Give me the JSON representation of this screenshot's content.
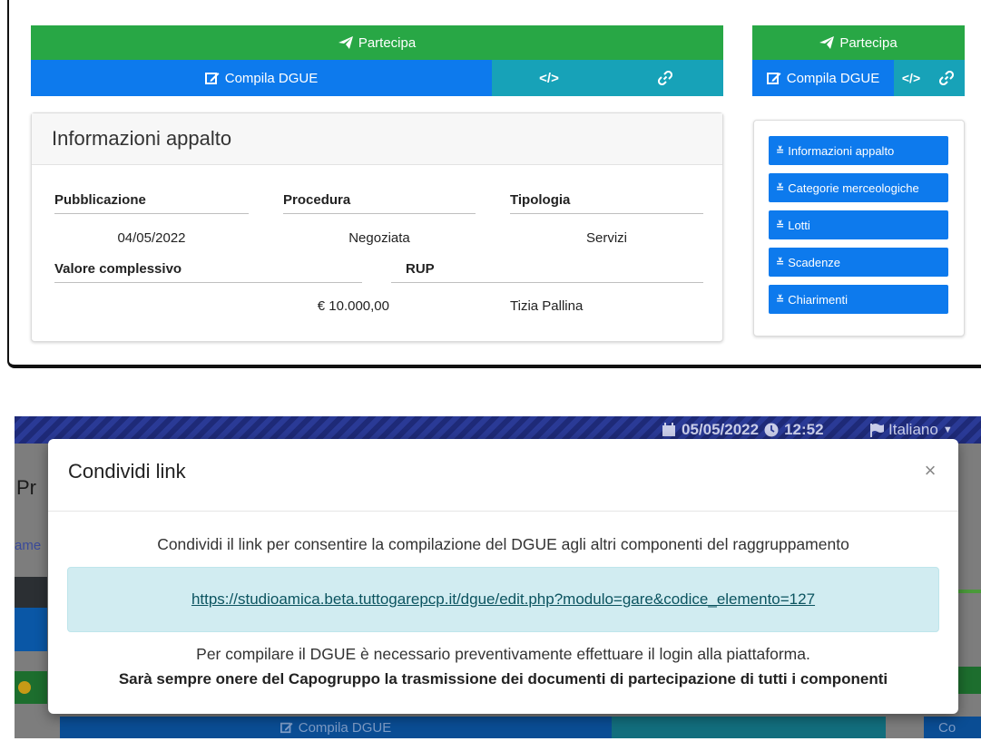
{
  "top": {
    "main_actions": {
      "participate_label": "Partecipa",
      "compile_label": "Compila DGUE",
      "embed_label": "</>"
    },
    "side_actions": {
      "participate_label": "Partecipa",
      "compile_label": "Compila DGUE",
      "embed_label": "</>"
    },
    "info_card": {
      "title": "Informazioni appalto",
      "headers_row1": [
        "Pubblicazione",
        "Procedura",
        "Tipologia"
      ],
      "values_row1": [
        "04/05/2022",
        "Negoziata",
        "Servizi"
      ],
      "headers_row2": [
        "Valore complessivo",
        "RUP"
      ],
      "values_row2": [
        "€ 10.000,00",
        "Tizia Pallina"
      ]
    },
    "side_menu": [
      {
        "label": "Informazioni appalto"
      },
      {
        "label": "Categorie merceologiche"
      },
      {
        "label": "Lotti"
      },
      {
        "label": "Scadenze"
      },
      {
        "label": "Chiarimenti"
      }
    ]
  },
  "bottom": {
    "header": {
      "date": "05/05/2022",
      "time": "12:52",
      "language": "Italiano"
    },
    "background_fragments": {
      "left_title": "Pr",
      "left_tab": "ame",
      "compile_label": "Compila DGUE",
      "right_fragment": "Co"
    },
    "modal": {
      "title": "Condividi link",
      "close_symbol": "×",
      "intro": "Condividi il link per consentire la compilazione del DGUE agli altri componenti del raggruppamento",
      "link": "https://studioamica.beta.tuttogarepcp.it/dgue/edit.php?modulo=gare&codice_elemento=127",
      "note": "Per compilare il DGUE è necessario preventivamente effettuare il login alla piattaforma.",
      "warning": "Sarà sempre onere del Capogruppo la trasmissione dei documenti di partecipazione di tutti i componenti"
    }
  }
}
